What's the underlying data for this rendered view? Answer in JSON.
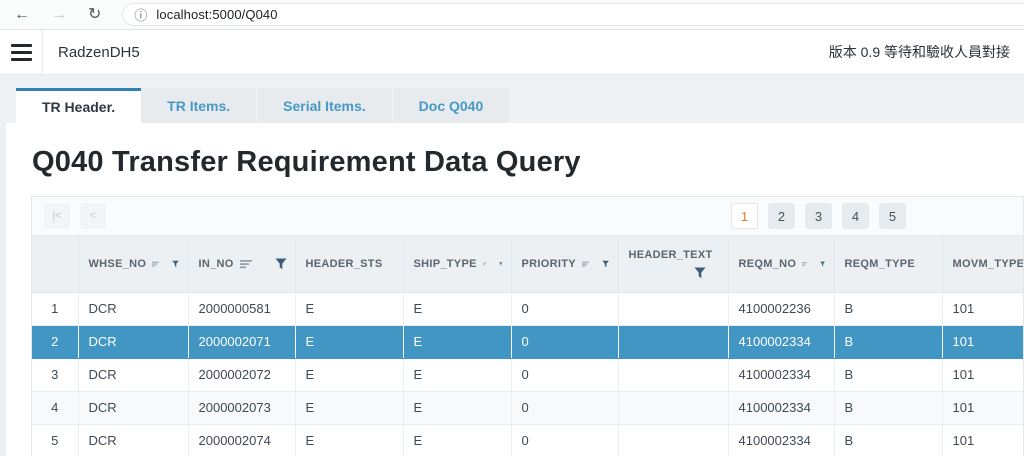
{
  "browser": {
    "back_icon": "←",
    "forward_icon": "→",
    "reload_icon": "↻",
    "info_icon": "ⓘ",
    "url": "localhost:5000/Q040"
  },
  "header": {
    "brand": "RadzenDH5",
    "version_note": "版本 0.9 等待和驗收人員對接"
  },
  "tabs": [
    {
      "label": "TR Header.",
      "active": true
    },
    {
      "label": "TR Items.",
      "active": false
    },
    {
      "label": "Serial Items.",
      "active": false
    },
    {
      "label": "Doc Q040",
      "active": false
    }
  ],
  "page": {
    "title": "Q040 Transfer Requirement Data Query"
  },
  "grid": {
    "pager": {
      "first_label": "|<",
      "prev_label": "<",
      "pages": [
        "1",
        "2",
        "3",
        "4",
        "5"
      ],
      "current_page": "1"
    },
    "columns": [
      {
        "label": "WHSE_NO",
        "wrap_filter": false
      },
      {
        "label": "IN_NO",
        "wrap_filter": false
      },
      {
        "label": "HEADER_STS",
        "wrap_filter": false
      },
      {
        "label": "SHIP_TYPE",
        "wrap_filter": false
      },
      {
        "label": "PRIORITY",
        "wrap_filter": false
      },
      {
        "label": "HEADER_TEXT",
        "wrap_filter": true
      },
      {
        "label": "REQM_NO",
        "wrap_filter": false
      },
      {
        "label": "REQM_TYPE",
        "wrap_filter": false
      },
      {
        "label": "MOVM_TYPE",
        "wrap_filter": false
      }
    ],
    "rows": [
      {
        "num": "1",
        "selected": false,
        "cells": [
          "DCR",
          "2000000581",
          "E",
          "E",
          "0",
          "",
          "4100002236",
          "B",
          "101"
        ]
      },
      {
        "num": "2",
        "selected": true,
        "cells": [
          "DCR",
          "2000002071",
          "E",
          "E",
          "0",
          "",
          "4100002334",
          "B",
          "101"
        ]
      },
      {
        "num": "3",
        "selected": false,
        "cells": [
          "DCR",
          "2000002072",
          "E",
          "E",
          "0",
          "",
          "4100002334",
          "B",
          "101"
        ]
      },
      {
        "num": "4",
        "selected": false,
        "cells": [
          "DCR",
          "2000002073",
          "E",
          "E",
          "0",
          "",
          "4100002334",
          "B",
          "101"
        ]
      },
      {
        "num": "5",
        "selected": false,
        "cells": [
          "DCR",
          "2000002074",
          "E",
          "E",
          "0",
          "",
          "4100002334",
          "B",
          "101"
        ]
      }
    ],
    "icons": {
      "sort": "sort-lines-icon",
      "filter": "filter-funnel-icon"
    }
  },
  "colors": {
    "accent_blue": "#2f82b6",
    "tab_link": "#4898c7",
    "selected_row": "#4196c4",
    "active_page": "#ec7524",
    "filter_icon": "#3d5d78",
    "sort_icon": "#98a2aa"
  }
}
